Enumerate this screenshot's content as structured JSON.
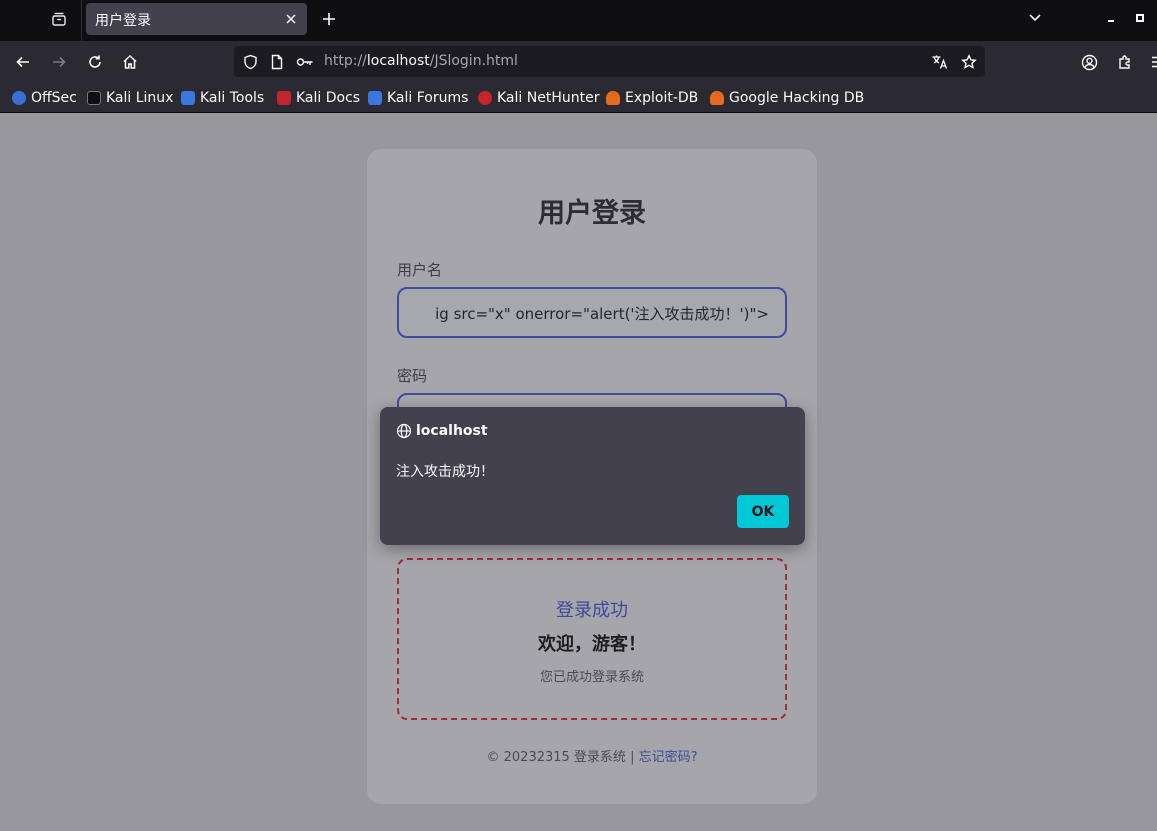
{
  "browser": {
    "tab": {
      "title": "用户登录"
    },
    "url": {
      "prefix": "http://",
      "host": "localhost",
      "path": "/JSlogin.html"
    },
    "bookmarks": [
      {
        "label": "OffSec",
        "icon": "offsec-icon",
        "color": "#3b6fd6"
      },
      {
        "label": "Kali Linux",
        "icon": "kali-dragon-icon",
        "color": "#0f0f12"
      },
      {
        "label": "Kali Tools",
        "icon": "kali-tools-icon",
        "color": "#3a78e0"
      },
      {
        "label": "Kali Docs",
        "icon": "kali-docs-icon",
        "color": "#c4242f"
      },
      {
        "label": "Kali Forums",
        "icon": "kali-forums-icon",
        "color": "#3a78e0"
      },
      {
        "label": "Kali NetHunter",
        "icon": "nethunter-icon",
        "color": "#c4242f"
      },
      {
        "label": "Exploit-DB",
        "icon": "exploitdb-icon",
        "color": "#e56a1f"
      },
      {
        "label": "Google Hacking DB",
        "icon": "ghdb-icon",
        "color": "#e56a1f"
      }
    ]
  },
  "page": {
    "title": "用户登录",
    "username": {
      "label": "用户名",
      "value": "ig src=\"x\" onerror=\"alert('注入攻击成功！')\">"
    },
    "password": {
      "label": "密码",
      "value": ""
    },
    "result": {
      "title": "登录成功",
      "welcome": "欢迎，游客！",
      "subtitle": "您已成功登录系统"
    },
    "footer": {
      "text": "© 20232315 登录系统 | ",
      "link": "忘记密码?"
    }
  },
  "dialog": {
    "origin": "localhost",
    "message": "注入攻击成功！",
    "ok_label": "OK"
  },
  "colors": {
    "accent": "#00c8d7",
    "link": "#3c4b97",
    "dashed_border": "#a02b3a"
  }
}
